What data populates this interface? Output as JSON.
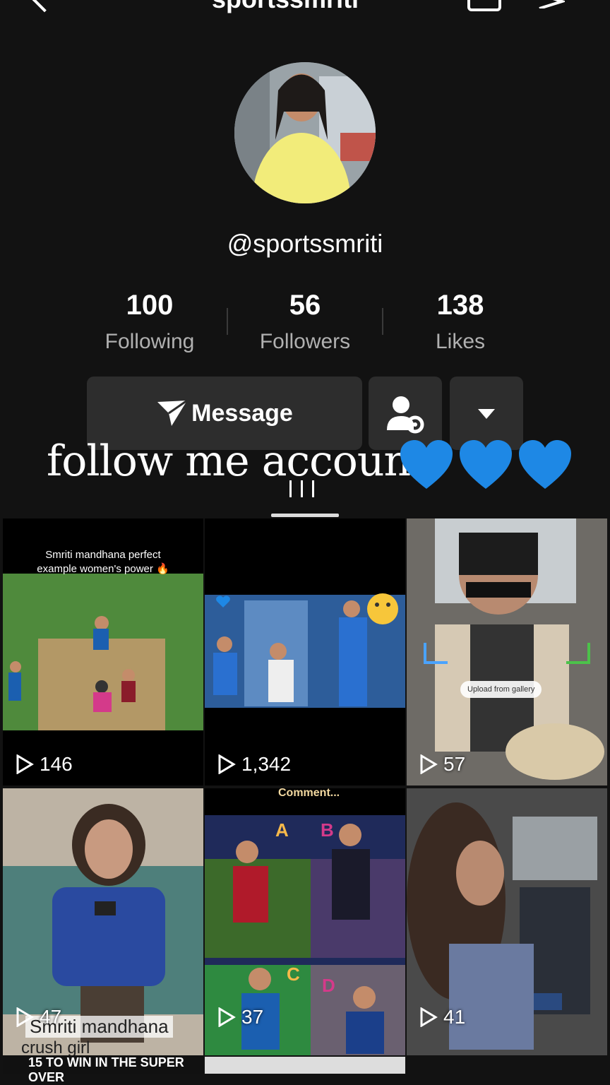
{
  "header": {
    "handle_partial": "sportssmriti"
  },
  "profile": {
    "username": "@sportssmriti",
    "stats": [
      {
        "value": "100",
        "label": "Following"
      },
      {
        "value": "56",
        "label": "Followers"
      },
      {
        "value": "138",
        "label": "Likes"
      }
    ]
  },
  "actions": {
    "message_label": "Message"
  },
  "caption": {
    "text": "follow me account"
  },
  "videos": [
    {
      "views": "146",
      "overlay": "Smriti mandhana perfect example women's power 🔥"
    },
    {
      "views": "1,342",
      "overlay": ""
    },
    {
      "views": "57",
      "overlay": "Upload from gallery"
    },
    {
      "views": "47",
      "overlay": "Smriti mandhana",
      "overlay2": "crush girl",
      "overlay3": "15 TO WIN IN THE SUPER OVER"
    },
    {
      "views": "37",
      "overlay": "Comment..."
    },
    {
      "views": "41",
      "overlay": ""
    }
  ],
  "colors": {
    "background": "#121212",
    "button": "#2d2d2d",
    "heart": "#1e88e5"
  }
}
